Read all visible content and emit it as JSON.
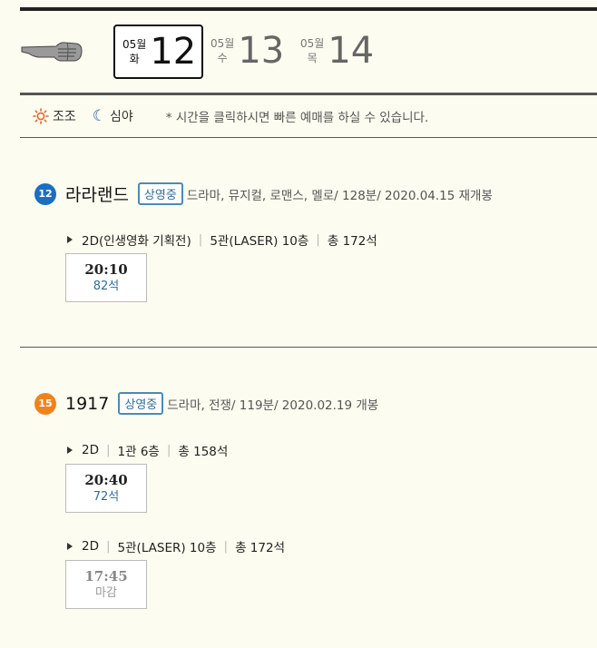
{
  "date_nav": {
    "dates": [
      {
        "month": "05월",
        "weekday": "화",
        "day": "12"
      },
      {
        "month": "05월",
        "weekday": "수",
        "day": "13"
      },
      {
        "month": "05월",
        "weekday": "목",
        "day": "14"
      }
    ]
  },
  "legend": {
    "morning": "조조",
    "night": "심야",
    "note": "* 시간을 클릭하시면 빠른 예매를 하실 수 있습니다."
  },
  "movies": [
    {
      "age": "12",
      "age_color": "#1a6fc0",
      "title": "라라랜드",
      "status": "상영중",
      "meta": "드라마, 뮤지컬, 로맨스, 멜로/ 128분/ 2020.04.15 재개봉",
      "halls": [
        {
          "format": "2D(인생영화 기획전)",
          "screen": "5관(LASER) 10층",
          "seats": "총 172석",
          "times": [
            {
              "time": "20:10",
              "seats": "82석"
            }
          ]
        }
      ]
    },
    {
      "age": "15",
      "age_color": "#f0821e",
      "title": "1917",
      "status": "상영중",
      "meta": "드라마, 전쟁/ 119분/ 2020.02.19 개봉",
      "halls": [
        {
          "format": "2D",
          "screen": "1관 6층",
          "seats": "총 158석",
          "times": [
            {
              "time": "20:40",
              "seats": "72석"
            }
          ]
        },
        {
          "format": "2D",
          "screen": "5관(LASER) 10층",
          "seats": "총 172석",
          "times": [
            {
              "time": "17:45",
              "seats": "마감"
            }
          ]
        }
      ]
    }
  ]
}
